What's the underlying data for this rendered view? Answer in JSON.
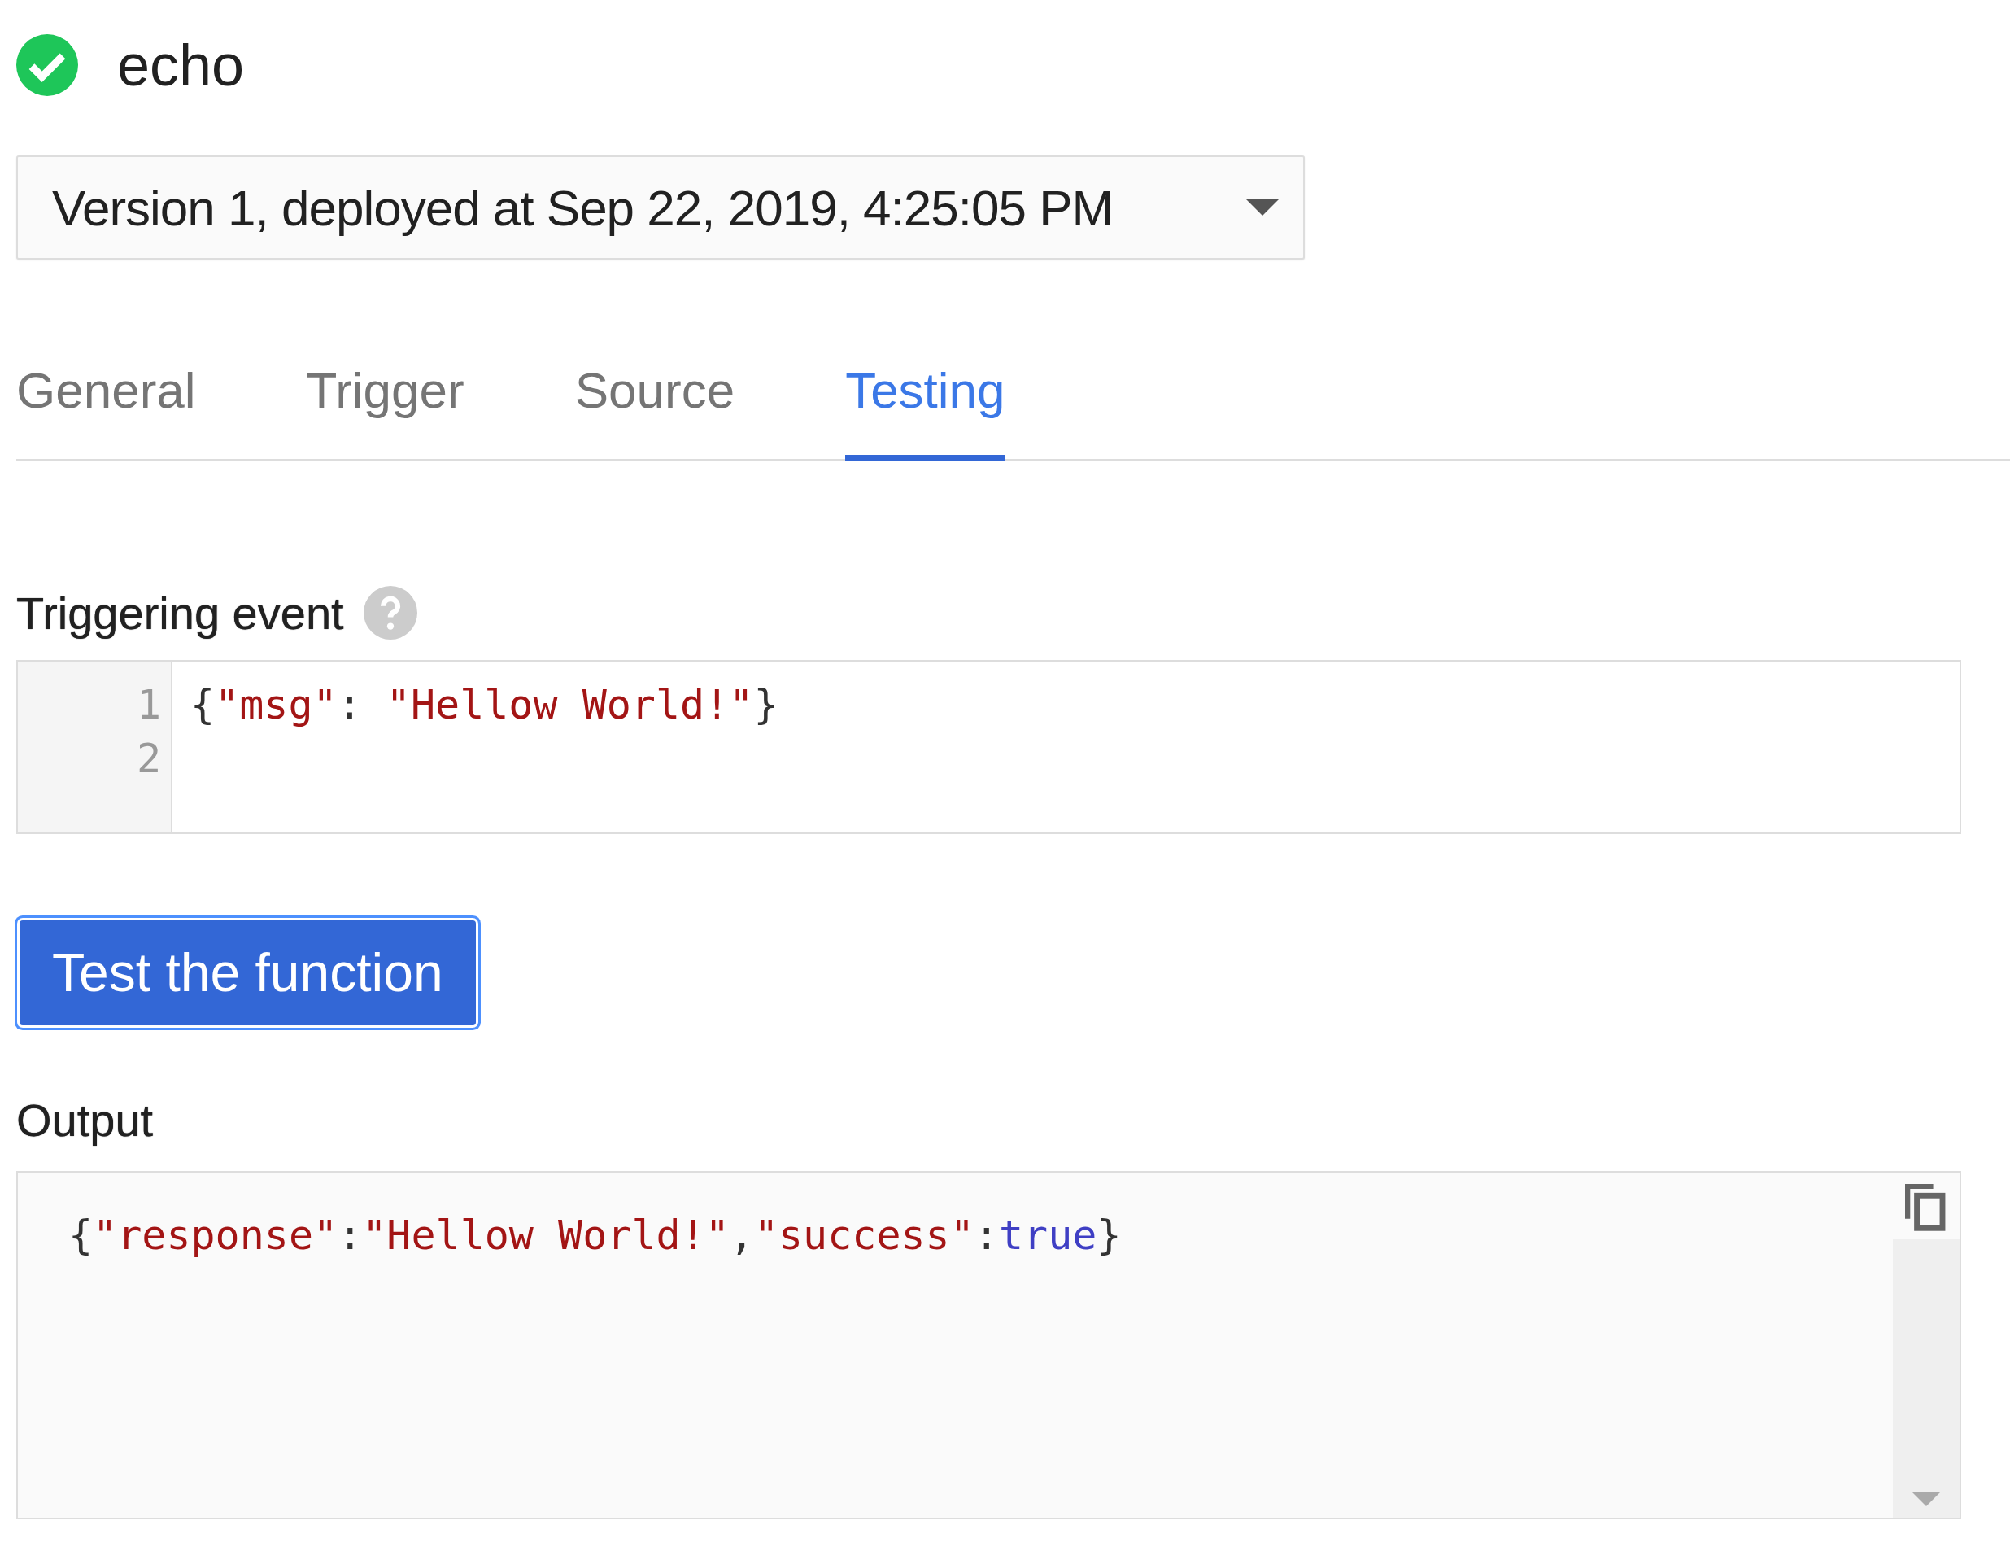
{
  "function": {
    "name": "echo",
    "deployed_ok": true
  },
  "version_select": {
    "value": "Version 1, deployed at Sep 22, 2019, 4:25:05 PM"
  },
  "tabs": [
    {
      "label": "General",
      "selected": false
    },
    {
      "label": "Trigger",
      "selected": false
    },
    {
      "label": "Source",
      "selected": false
    },
    {
      "label": "Testing",
      "selected": true
    }
  ],
  "triggering_event": {
    "label": "Triggering event",
    "lines": [
      {
        "number": "1",
        "tokens": [
          {
            "kind": "punct",
            "text": "{"
          },
          {
            "kind": "string",
            "text": "\"msg\""
          },
          {
            "kind": "punct",
            "text": ": "
          },
          {
            "kind": "string",
            "text": "\"Hellow World!\""
          },
          {
            "kind": "punct",
            "text": "}"
          }
        ]
      },
      {
        "number": "2"
      }
    ]
  },
  "test_button": {
    "label": "Test the function"
  },
  "output": {
    "label": "Output",
    "tokens": [
      {
        "kind": "punct",
        "text": "{"
      },
      {
        "kind": "string",
        "text": "\"response\""
      },
      {
        "kind": "punct",
        "text": ":"
      },
      {
        "kind": "string",
        "text": "\"Hellow World!\""
      },
      {
        "kind": "punct",
        "text": ","
      },
      {
        "kind": "string",
        "text": "\"success\""
      },
      {
        "kind": "punct",
        "text": ":"
      },
      {
        "kind": "bool",
        "text": "true"
      },
      {
        "kind": "punct",
        "text": "}"
      }
    ]
  }
}
